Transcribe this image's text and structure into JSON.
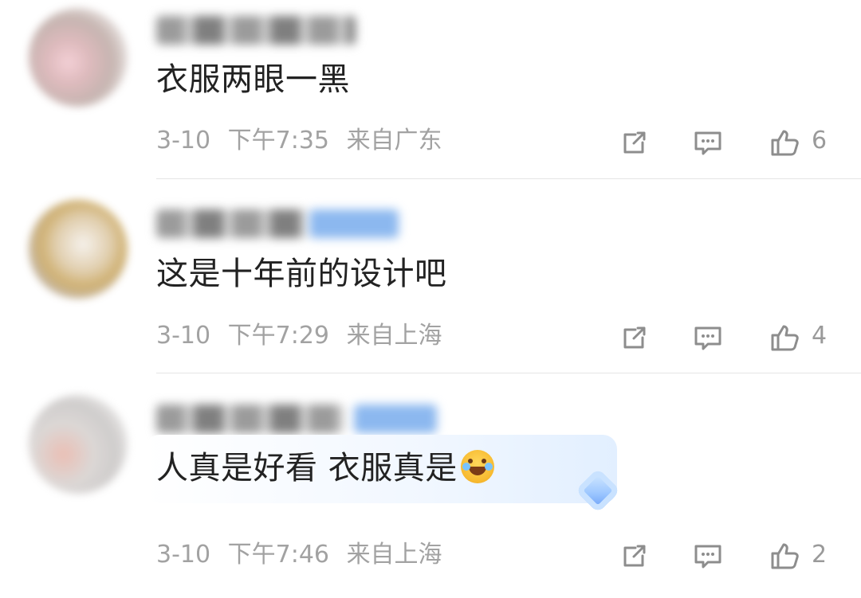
{
  "comments": [
    {
      "text": "衣服两眼一黑",
      "date": "3-10",
      "time": "下午7:35",
      "location": "来自广东",
      "likes": "6"
    },
    {
      "text": "这是十年前的设计吧",
      "date": "3-10",
      "time": "下午7:29",
      "location": "来自上海",
      "likes": "4"
    },
    {
      "text": "人真是好看 衣服真是",
      "emoji_icon": "laughing-tears-emoji",
      "decoration_icon": "blue-diamond-badge-icon",
      "date": "3-10",
      "time": "下午7:46",
      "location": "来自上海",
      "likes": "2"
    }
  ],
  "icons": {
    "share": "share-icon",
    "reply": "comment-icon",
    "like": "thumbs-up-icon"
  },
  "colors": {
    "text": "#222222",
    "meta": "#a2a2a2",
    "divider": "#e5e5e5",
    "blue_badge": "#8cb8ef"
  }
}
